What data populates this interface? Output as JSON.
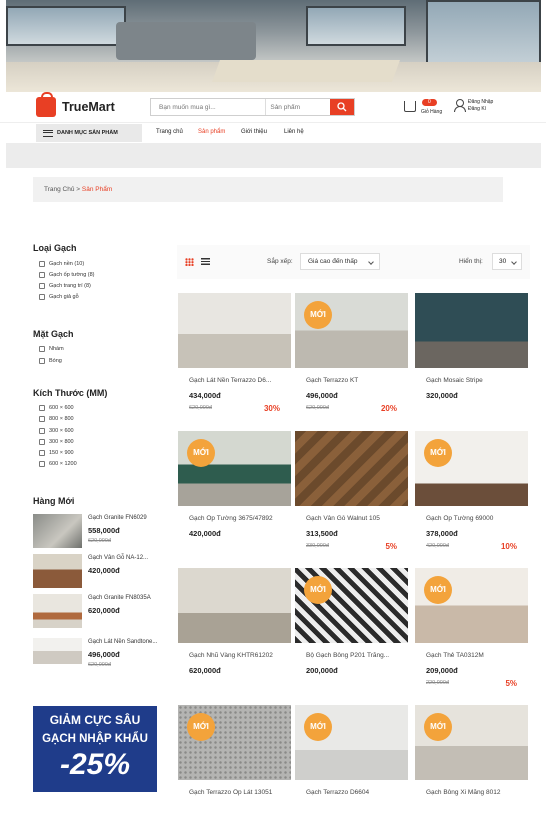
{
  "brand": {
    "name": "TrueMart",
    "accent": "#e83f24",
    "badge_color": "#f3a33b"
  },
  "search": {
    "placeholder": "Bạn muốn mua gì...",
    "category_placeholder": "Sản phẩm"
  },
  "cart": {
    "badge": "0",
    "label": "Giỏ Hàng"
  },
  "account": {
    "login": "Đăng Nhập",
    "register": "Đăng Kí"
  },
  "nav": {
    "menu_label": "DANH MỤC SẢN PHẨM",
    "links": [
      "Trang chủ",
      "Sản phẩm",
      "Giới thiệu",
      "Liên hệ"
    ]
  },
  "breadcrumb": {
    "home": "Trang Chủ",
    "sep": ">",
    "current": "Sản Phẩm"
  },
  "sidebar": {
    "loai_gach": {
      "title": "Loại Gạch",
      "items": [
        "Gạch nền (10)",
        "Gạch ốp tường (8)",
        "Gạch trang trí (8)",
        "Gạch giả gỗ"
      ]
    },
    "mat_gach": {
      "title": "Mặt Gạch",
      "items": [
        "Nhám",
        "Bóng"
      ]
    },
    "kich_thuoc": {
      "title": "Kích Thước (MM)",
      "items": [
        "600 × 600",
        "800 × 800",
        "300 × 600",
        "300 × 800",
        "150 × 900",
        "600 × 1200"
      ]
    },
    "hang_moi": {
      "title": "Hàng Mới",
      "items": [
        {
          "name": "Gạch Granite FN6029",
          "price": "558,000đ",
          "old": "620,000đ"
        },
        {
          "name": "Gạch Vân Gỗ NA-12...",
          "price": "420,000đ",
          "old": ""
        },
        {
          "name": "Gạch Granite FN8035A",
          "price": "620,000đ",
          "old": ""
        },
        {
          "name": "Gạch Lát Nền Sandtone...",
          "price": "496,000đ",
          "old": "620,000đ"
        }
      ]
    },
    "banner": {
      "line1": "GIẢM CỰC SÂU",
      "line2": "GẠCH NHẬP KHẨU",
      "line3": "-25%"
    }
  },
  "toolbar": {
    "sort_label": "Sắp xếp:",
    "sort_value": "Giá cao đến thấp",
    "show_label": "Hiển thị:",
    "show_value": "30"
  },
  "new_badge": "MỚI",
  "products": [
    {
      "name": "Gạch Lát Nền Terrazzo D6...",
      "price": "434,000đ",
      "old": "620,000đ",
      "discount": "30%",
      "new": false
    },
    {
      "name": "Gạch Terrazzo KT",
      "price": "496,000đ",
      "old": "620,000đ",
      "discount": "20%",
      "new": true
    },
    {
      "name": "Gạch Mosaic Stripe",
      "price": "320,000đ",
      "old": "",
      "discount": "",
      "new": false
    },
    {
      "name": "Gạch Ốp Tường 3675/47892",
      "price": "420,000đ",
      "old": "",
      "discount": "",
      "new": true
    },
    {
      "name": "Gạch Vân Gỗ Walnut 105",
      "price": "313,500đ",
      "old": "330,000đ",
      "discount": "5%",
      "new": false
    },
    {
      "name": "Gạch Ốp Tường 69000",
      "price": "378,000đ",
      "old": "420,000đ",
      "discount": "10%",
      "new": true
    },
    {
      "name": "Gạch Nhũ Vàng KHTR61202",
      "price": "620,000đ",
      "old": "",
      "discount": "",
      "new": false
    },
    {
      "name": "Bộ Gạch Bông P201 Trắng...",
      "price": "200,000đ",
      "old": "",
      "discount": "",
      "new": true
    },
    {
      "name": "Gạch Thẻ TA0312M",
      "price": "209,000đ",
      "old": "220,000đ",
      "discount": "5%",
      "new": true
    },
    {
      "name": "Gạch Terrazzo Ốp Lát 13051",
      "price": "",
      "old": "",
      "discount": "",
      "new": true
    },
    {
      "name": "Gạch Terrazzo D6604",
      "price": "",
      "old": "",
      "discount": "",
      "new": true
    },
    {
      "name": "Gạch Bông Xi Măng 8012",
      "price": "",
      "old": "",
      "discount": "",
      "new": true
    }
  ]
}
